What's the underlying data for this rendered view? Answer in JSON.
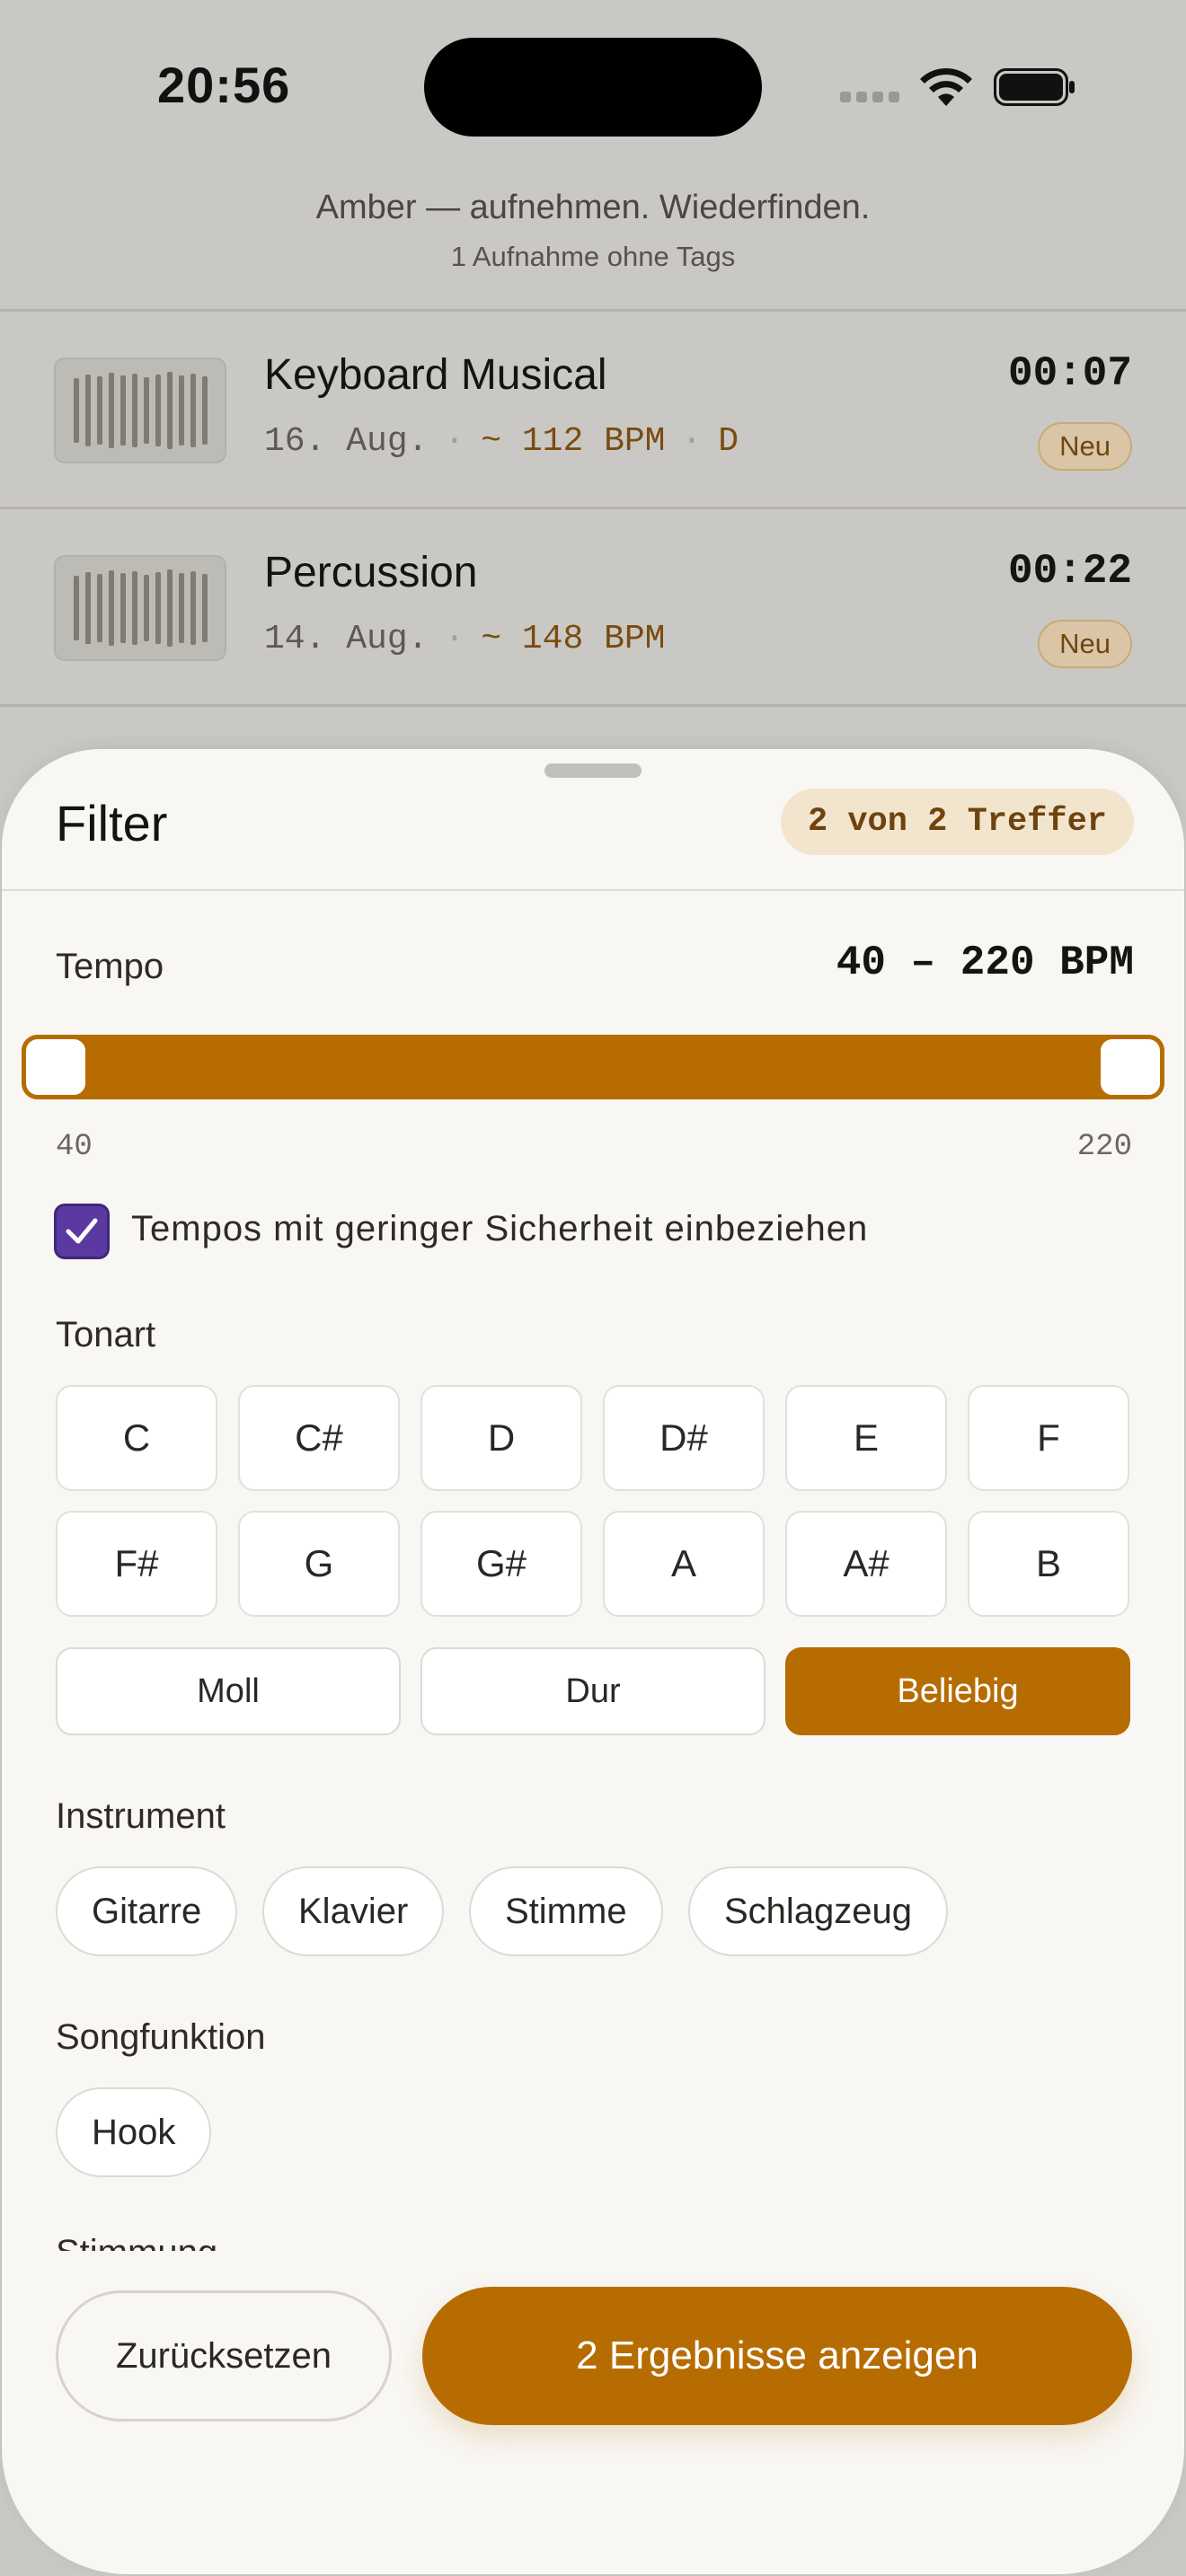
{
  "status_bar": {
    "time": "20:56"
  },
  "header": {
    "tagline": "Amber — aufnehmen. Wiederfinden.",
    "untagged_note": "1 Aufnahme ohne Tags"
  },
  "recordings": [
    {
      "title": "Keyboard Musical",
      "date": "16. Aug.",
      "bpm": "~ 112 BPM",
      "key": "D",
      "duration": "00:07",
      "badge": "Neu"
    },
    {
      "title": "Percussion",
      "date": "14. Aug.",
      "bpm": "~ 148 BPM",
      "key": "",
      "duration": "00:22",
      "badge": "Neu"
    }
  ],
  "filter_sheet": {
    "title": "Filter",
    "match_count": "2 von 2 Treffer",
    "tempo": {
      "label": "Tempo",
      "range_text": "40 – 220 BPM",
      "min_label": "40",
      "max_label": "220",
      "min": 40,
      "max": 220,
      "selected_low": 40,
      "selected_high": 220,
      "include_low_confidence_label": "Tempos mit geringer Sicherheit einbeziehen",
      "include_low_confidence": true
    },
    "key": {
      "label": "Tonart",
      "notes": [
        "C",
        "C#",
        "D",
        "D#",
        "E",
        "F",
        "F#",
        "G",
        "G#",
        "A",
        "A#",
        "B"
      ],
      "modes": [
        "Moll",
        "Dur",
        "Beliebig"
      ],
      "selected_mode": "Beliebig"
    },
    "instrument": {
      "label": "Instrument",
      "options": [
        "Gitarre",
        "Klavier",
        "Stimme",
        "Schlagzeug"
      ]
    },
    "song_function": {
      "label": "Songfunktion",
      "options": [
        "Hook"
      ]
    },
    "next_section_label": "Stimmung",
    "reset_label": "Zurücksetzen",
    "apply_label": "2 Ergebnisse anzeigen"
  },
  "colors": {
    "accent": "#b66c00",
    "checkbox": "#5a3aa0",
    "badge_bg": "#f3e5cd",
    "sheet_bg": "#f8f7f3",
    "dimmed_bg": "#c9c8c4"
  }
}
